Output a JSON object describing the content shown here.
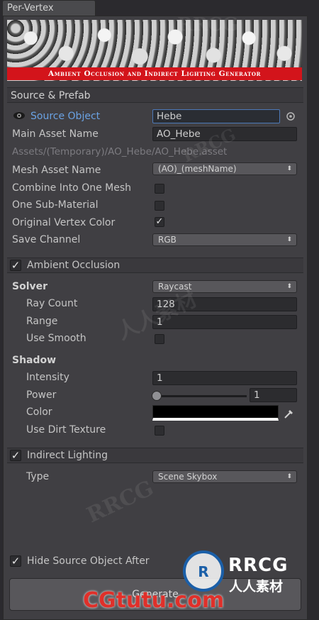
{
  "tab": {
    "title": "Per-Vertex"
  },
  "banner": {
    "title": "Ambient Occlusion and Indirect Lighting Generator"
  },
  "source_prefab": {
    "header": "Source & Prefab",
    "source_object_label": "Source Object",
    "source_object_value": "Hebe",
    "main_asset_label": "Main Asset Name",
    "main_asset_value": "AO_Hebe",
    "asset_path": "Assets/(Temporary)/AO_Hebe/AO_Hebe.asset",
    "mesh_asset_label": "Mesh Asset Name",
    "mesh_asset_value": "(AO)_(meshName)",
    "combine_label": "Combine Into One Mesh",
    "combine_checked": false,
    "one_sub_label": "One Sub-Material",
    "one_sub_checked": false,
    "orig_color_label": "Original Vertex Color",
    "orig_color_checked": true,
    "save_channel_label": "Save Channel",
    "save_channel_value": "RGB"
  },
  "ambient_occlusion": {
    "header": "Ambient Occlusion",
    "enabled": true,
    "solver_label": "Solver",
    "solver_value": "Raycast",
    "ray_count_label": "Ray Count",
    "ray_count_value": "128",
    "range_label": "Range",
    "range_value": "1",
    "use_smooth_label": "Use Smooth",
    "use_smooth_checked": false,
    "shadow_label": "Shadow",
    "intensity_label": "Intensity",
    "intensity_value": "1",
    "power_label": "Power",
    "power_value": "1",
    "color_label": "Color",
    "color_value": "#000000",
    "dirt_label": "Use Dirt Texture",
    "dirt_checked": false
  },
  "indirect_lighting": {
    "header": "Indirect Lighting",
    "enabled": true,
    "type_label": "Type",
    "type_value": "Scene Skybox"
  },
  "footer": {
    "hide_source_label": "Hide Source Object After",
    "hide_source_checked": true,
    "generate_label": "Generate"
  },
  "watermark": {
    "text_main": "RRCG",
    "text_cn": "人人素材",
    "site": "CGtutu.com"
  },
  "icons": {
    "eye": "eye-icon",
    "target": "object-picker-icon",
    "check": "check-icon",
    "arrow": "dropdown-arrow-icon",
    "eyedropper": "eyedropper-icon"
  }
}
